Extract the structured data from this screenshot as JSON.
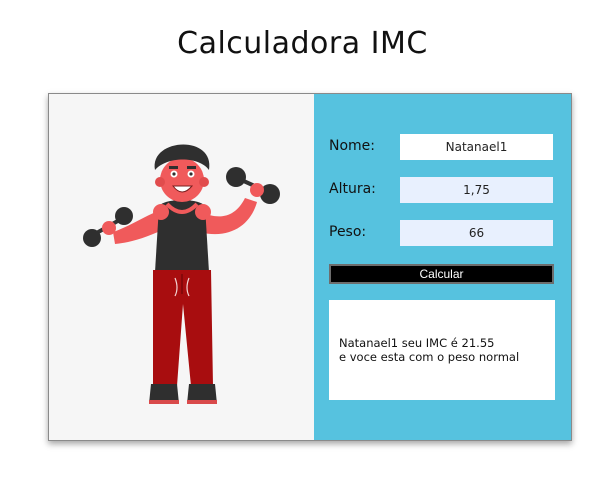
{
  "page": {
    "title": "Calculadora IMC"
  },
  "form": {
    "name_label": "Nome:",
    "name_value": "Natanael1",
    "height_label": "Altura:",
    "height_value": "1,75",
    "weight_label": "Peso:",
    "weight_value": "66",
    "submit_label": "Calcular"
  },
  "result": {
    "line1": "Natanael1 seu IMC é 21.55",
    "line2": "e voce esta com o peso normal"
  },
  "colors": {
    "form_panel": "#56c2df",
    "illustration_bg": "#f6f6f6",
    "button_bg": "#000000",
    "tinted_field": "#e8f0fe"
  },
  "icons": [
    "fitness-man-illustration",
    "dumbbell-icon"
  ]
}
